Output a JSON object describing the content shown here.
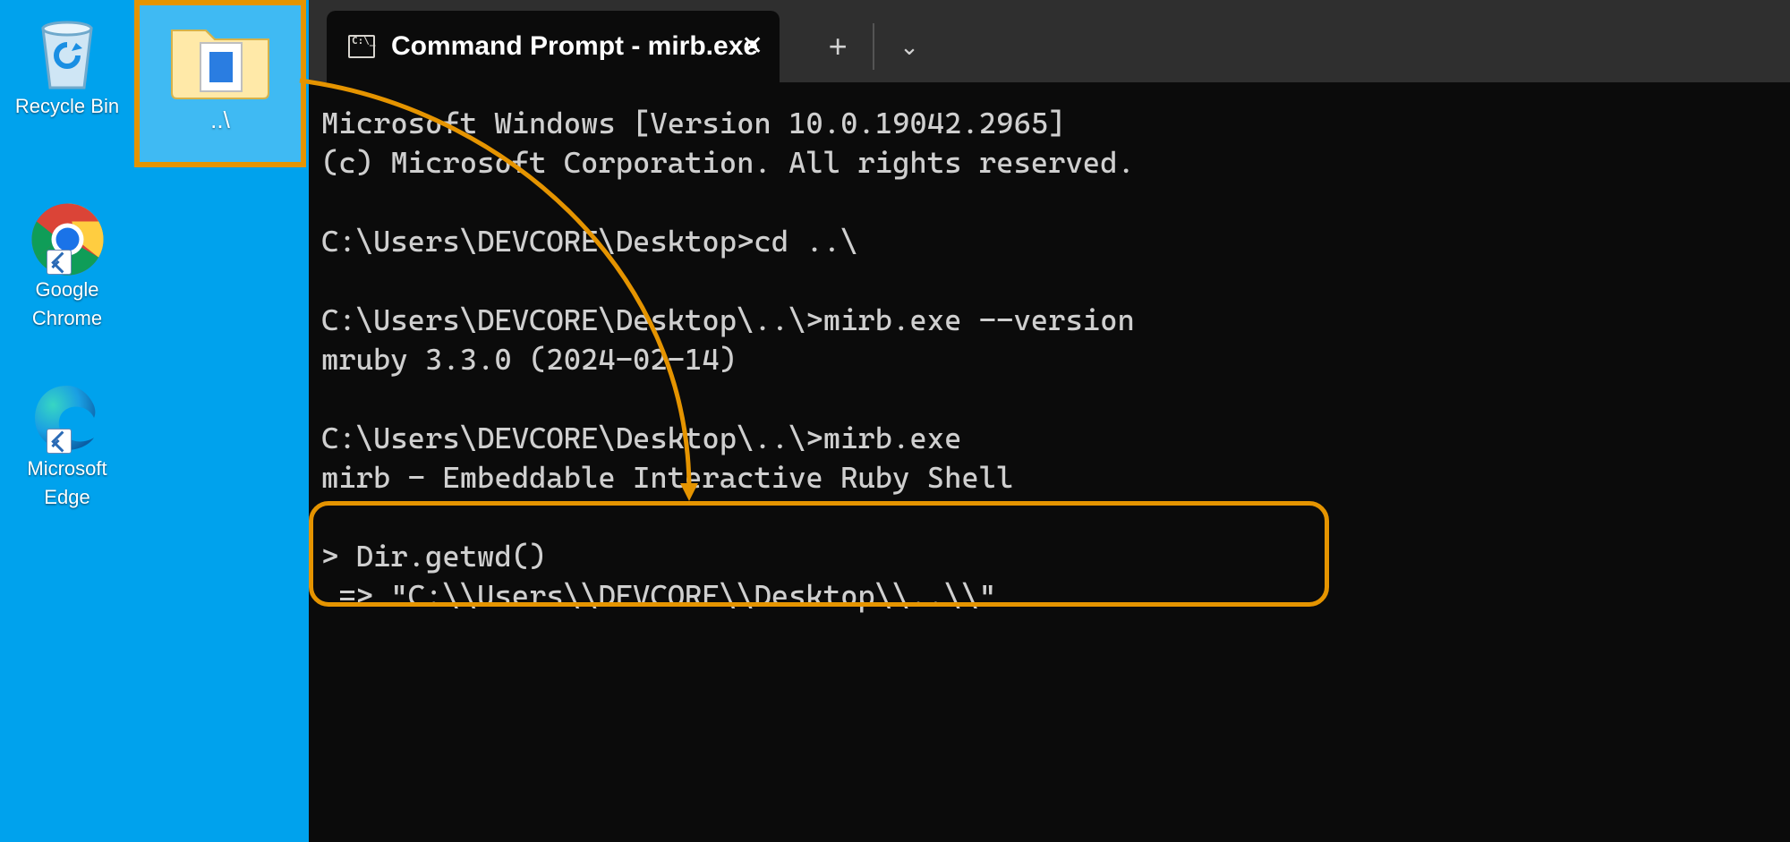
{
  "desktop": {
    "icons": {
      "recycle_bin_label": "Recycle Bin",
      "folder_label": "..\\",
      "chrome_label_1": "Google",
      "chrome_label_2": "Chrome",
      "edge_label_1": "Microsoft",
      "edge_label_2": "Edge"
    }
  },
  "terminal": {
    "tab_title": "Command Prompt - mirb.exe",
    "lines": {
      "l1": "Microsoft Windows [Version 10.0.19042.2965]",
      "l2": "(c) Microsoft Corporation. All rights reserved.",
      "l3": "",
      "l4": "C:\\Users\\DEVCORE\\Desktop>cd ..\\",
      "l5": "",
      "l6": "C:\\Users\\DEVCORE\\Desktop\\..\\>mirb.exe --version",
      "l7": "mruby 3.3.0 (2024-02-14)",
      "l8": "",
      "l9": "C:\\Users\\DEVCORE\\Desktop\\..\\>mirb.exe",
      "l10": "mirb - Embeddable Interactive Ruby Shell",
      "l11": "",
      "l12": "> Dir.getwd()",
      "l13": " => \"C:\\\\Users\\\\DEVCORE\\\\Desktop\\\\..\\\\\""
    }
  },
  "annotations": {
    "highlight_color": "#e59400"
  }
}
